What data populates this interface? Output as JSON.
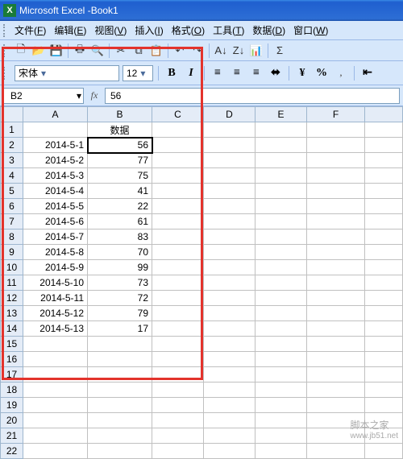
{
  "title_prefix": "Microsoft Excel - ",
  "title_doc": "Book1",
  "menus": [
    {
      "label": "文件",
      "key": "F"
    },
    {
      "label": "编辑",
      "key": "E"
    },
    {
      "label": "视图",
      "key": "V"
    },
    {
      "label": "插入",
      "key": "I"
    },
    {
      "label": "格式",
      "key": "O"
    },
    {
      "label": "工具",
      "key": "T"
    },
    {
      "label": "数据",
      "key": "D"
    },
    {
      "label": "窗口",
      "key": "W"
    }
  ],
  "font_name": "宋体",
  "font_size": "12",
  "name_box": "B2",
  "formula_value": "56",
  "columns": [
    "A",
    "B",
    "C",
    "D",
    "E",
    "F",
    ""
  ],
  "row_numbers": [
    1,
    2,
    3,
    4,
    5,
    6,
    7,
    8,
    9,
    10,
    11,
    12,
    13,
    14,
    15,
    16,
    17,
    18,
    19,
    20,
    21,
    22
  ],
  "header_b": "数据",
  "rows": [
    {
      "a": "2014-5-1",
      "b": "56"
    },
    {
      "a": "2014-5-2",
      "b": "77"
    },
    {
      "a": "2014-5-3",
      "b": "75"
    },
    {
      "a": "2014-5-4",
      "b": "41"
    },
    {
      "a": "2014-5-5",
      "b": "22"
    },
    {
      "a": "2014-5-6",
      "b": "61"
    },
    {
      "a": "2014-5-7",
      "b": "83"
    },
    {
      "a": "2014-5-8",
      "b": "70"
    },
    {
      "a": "2014-5-9",
      "b": "99"
    },
    {
      "a": "2014-5-10",
      "b": "73"
    },
    {
      "a": "2014-5-11",
      "b": "72"
    },
    {
      "a": "2014-5-12",
      "b": "79"
    },
    {
      "a": "2014-5-13",
      "b": "17"
    }
  ],
  "watermark": {
    "line1": "脚本之家",
    "line2": "www.jb51.net"
  }
}
